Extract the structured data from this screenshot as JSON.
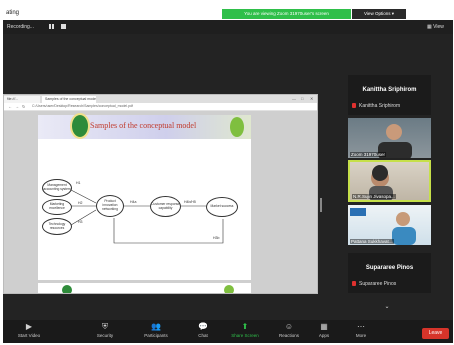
{
  "window": {
    "title": "ating"
  },
  "banner": {
    "share_text": "You are viewing Zoom 31970user's screen",
    "view_options": "View Options ▾"
  },
  "recording": {
    "label": "Recording...",
    "view": "View"
  },
  "browser": {
    "tabs": [
      "file:///...",
      "Samples of the conceptual model"
    ],
    "address": "C:/Users/user/Desktop/Research/Samples/conceptual_model.pdf",
    "controls": [
      "—",
      "□",
      "✕"
    ],
    "nav": [
      "←",
      "→",
      "↻"
    ]
  },
  "slide": {
    "title": "Samples of the conceptual model",
    "nodes": {
      "management": "Management accounting system",
      "marketing": "Marketing excellence",
      "technology": "Technology resources",
      "product": "Product innovation networking",
      "customer": "Customer response capability",
      "market": "Market success"
    },
    "tags": [
      "H1",
      "H2",
      "H3",
      "H4a",
      "H4b/H5",
      "H3b"
    ]
  },
  "participants": [
    {
      "name_big": "Kanittha Sriphirom",
      "name_small": "Kanittha Sriphirom"
    },
    {
      "video_label": "Zoom 31970user"
    },
    {
      "video_label": "N.R.Sujin Jivasopa..."
    },
    {
      "video_label": "Pattana Sukkhavat..."
    },
    {
      "name_big": "Supararee Pinos",
      "name_small": "Supararee Pinos"
    }
  ],
  "toolbar": {
    "items": [
      {
        "icon": "▶",
        "label": "Start Video"
      },
      {
        "icon": "⛨",
        "label": "Security"
      },
      {
        "icon": "👥",
        "label": "Participants"
      },
      {
        "icon": "💬",
        "label": "Chat"
      },
      {
        "icon": "⬆",
        "label": "Share Screen"
      },
      {
        "icon": "☺",
        "label": "Reactions"
      },
      {
        "icon": "▦",
        "label": "Apps"
      },
      {
        "icon": "⋯",
        "label": "More"
      }
    ],
    "end": "Leave"
  },
  "colors": {
    "accent_green": "#2fbf4a",
    "end_red": "#d6342a",
    "title_red": "#c0392b",
    "toolbar_bg": "#1a1a1a"
  }
}
